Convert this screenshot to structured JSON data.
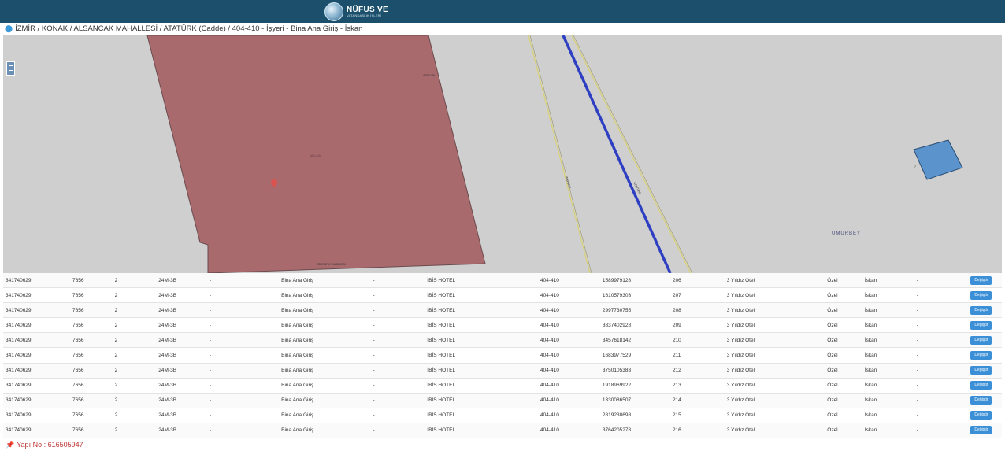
{
  "header": {
    "logo_main": "NÜFUS VE",
    "logo_sub": "VATANDAŞLIK İŞLERİ"
  },
  "breadcrumb": {
    "path": "İZMİR / KONAK / ALSANCAK MAHALLESİ / ATATÜRK (Cadde) / 404-410 - İşyeri - Bina Ana Giriş - İskan"
  },
  "map": {
    "parcel_label": "ATATÜRK",
    "parcel_center_label": "404-410",
    "building_bottom_label": "ATATÜRK CADDESİ",
    "road_label_1": "ATATÜRK",
    "road_label_2": "ATATÜRK",
    "small_poly_label": "7",
    "district_label": "UMURBEY"
  },
  "table": {
    "button_label": "Değiştir",
    "rows": [
      [
        "341740629",
        "7656",
        "2",
        "24M-3B",
        "-",
        "Bina Ana Giriş",
        "-",
        "İBİS HOTEL",
        "404-410",
        "1589979128",
        "206",
        "3 Yıldız Otel",
        "Özel",
        "İskan",
        "-"
      ],
      [
        "341740629",
        "7656",
        "2",
        "24M-3B",
        "-",
        "Bina Ana Giriş",
        "-",
        "İBİS HOTEL",
        "404-410",
        "1610579303",
        "207",
        "3 Yıldız Otel",
        "Özel",
        "İskan",
        "-"
      ],
      [
        "341740629",
        "7656",
        "2",
        "24M-3B",
        "-",
        "Bina Ana Giriş",
        "-",
        "İBİS HOTEL",
        "404-410",
        "2997730755",
        "208",
        "3 Yıldız Otel",
        "Özel",
        "İskan",
        "-"
      ],
      [
        "341740629",
        "7656",
        "2",
        "24M-3B",
        "-",
        "Bina Ana Giriş",
        "-",
        "İBİS HOTEL",
        "404-410",
        "8837402928",
        "209",
        "3 Yıldız Otel",
        "Özel",
        "İskan",
        "-"
      ],
      [
        "341740629",
        "7656",
        "2",
        "24M-3B",
        "-",
        "Bina Ana Giriş",
        "-",
        "İBİS HOTEL",
        "404-410",
        "3457618142",
        "210",
        "3 Yıldız Otel",
        "Özel",
        "İskan",
        "-"
      ],
      [
        "341740629",
        "7656",
        "2",
        "24M-3B",
        "-",
        "Bina Ana Giriş",
        "-",
        "İBİS HOTEL",
        "404-410",
        "1683977529",
        "211",
        "3 Yıldız Otel",
        "Özel",
        "İskan",
        "-"
      ],
      [
        "341740629",
        "7656",
        "2",
        "24M-3B",
        "-",
        "Bina Ana Giriş",
        "-",
        "İBİS HOTEL",
        "404-410",
        "3750105383",
        "212",
        "3 Yıldız Otel",
        "Özel",
        "İskan",
        "-"
      ],
      [
        "341740629",
        "7656",
        "2",
        "24M-3B",
        "-",
        "Bina Ana Giriş",
        "-",
        "İBİS HOTEL",
        "404-410",
        "1918969922",
        "213",
        "3 Yıldız Otel",
        "Özel",
        "İskan",
        "-"
      ],
      [
        "341740629",
        "7656",
        "2",
        "24M-3B",
        "-",
        "Bina Ana Giriş",
        "-",
        "İBİS HOTEL",
        "404-410",
        "1330086507",
        "214",
        "3 Yıldız Otel",
        "Özel",
        "İskan",
        "-"
      ],
      [
        "341740629",
        "7656",
        "2",
        "24M-3B",
        "-",
        "Bina Ana Giriş",
        "-",
        "İBİS HOTEL",
        "404-410",
        "2819238698",
        "215",
        "3 Yıldız Otel",
        "Özel",
        "İskan",
        "-"
      ],
      [
        "341740629",
        "7656",
        "2",
        "24M-3B",
        "-",
        "Bina Ana Giriş",
        "-",
        "İBİS HOTEL",
        "404-410",
        "3764205278",
        "216",
        "3 Yıldız Otel",
        "Özel",
        "İskan",
        "-"
      ]
    ]
  },
  "footer": {
    "yapi_no": "Yapı No : 616505947"
  }
}
